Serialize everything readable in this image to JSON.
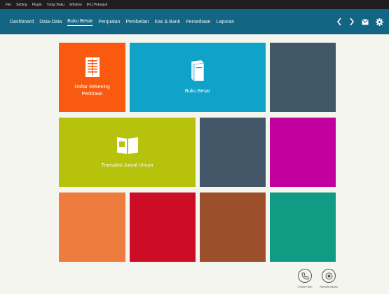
{
  "menu": {
    "items": [
      "File",
      "Setting",
      "Plugin",
      "Tutup Buku",
      "Window",
      "[F1] Petunjuk"
    ]
  },
  "nav": {
    "tabs": [
      "Dashboard",
      "Data-Data",
      "Buku Besar",
      "Penjualan",
      "Pembelian",
      "Kas & Bank",
      "Persediaan",
      "Laporan"
    ],
    "active": "Buku Besar"
  },
  "tiles": {
    "daftar_rekening": {
      "label": "Daftar Rekening\nPerkiraan",
      "color": "#fa5a0f"
    },
    "buku_besar": {
      "label": "Buku Besar",
      "color": "#0fa3c9"
    },
    "transaksi_jurnal": {
      "label": "Transaksi Jurnal Umum",
      "color": "#b6c20c"
    },
    "colors": {
      "slate_top": "#415866",
      "slate_mid": "#435768",
      "magenta": "#c2009d",
      "orange": "#ee7c3f",
      "red": "#cc0d25",
      "brown": "#9b4f2a",
      "teal": "#109c84"
    }
  },
  "help": {
    "online_help": "Online Help",
    "remote_akses": "Remote Akses"
  },
  "icons": {
    "nav_prev": "chevron-left-icon",
    "nav_next": "chevron-right-icon",
    "mail": "mail-icon",
    "settings": "gear-icon",
    "ledger": "ledger-icon",
    "book": "book-icon",
    "journal": "open-book-icon",
    "phone": "phone-icon",
    "remote": "remote-icon"
  }
}
